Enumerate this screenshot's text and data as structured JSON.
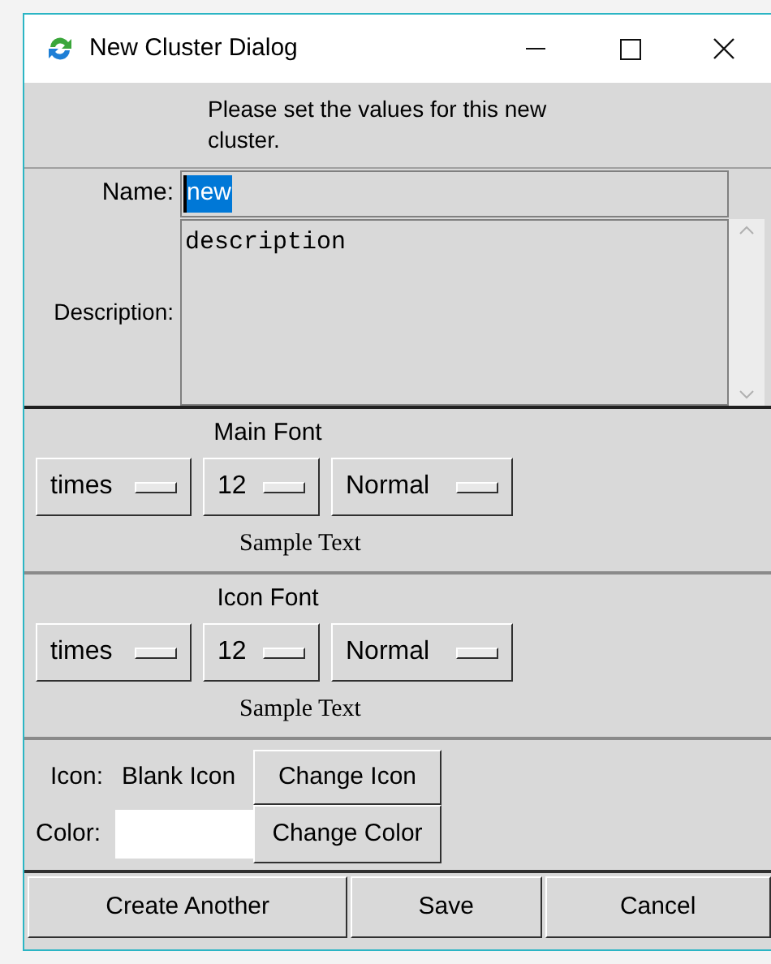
{
  "window": {
    "title": "New Cluster Dialog"
  },
  "message": "Please set the values for this new cluster.",
  "name_field": {
    "label": "Name:",
    "value": "new",
    "text_selected": true
  },
  "description_field": {
    "label": "Description:",
    "value": "description"
  },
  "font_sections": [
    {
      "title": "Main Font",
      "menus": [
        "times",
        "12",
        "Normal"
      ],
      "sample": "Sample Text"
    },
    {
      "title": "Icon Font",
      "menus": [
        "times",
        "12",
        "Normal"
      ],
      "sample": "Sample Text"
    }
  ],
  "icon_row": {
    "label": "Icon:",
    "value": "Blank Icon",
    "button": "Change Icon"
  },
  "color_row": {
    "label": "Color:",
    "color": "#ffffff",
    "button": "Change Color"
  },
  "buttons": [
    "Create Another",
    "Save",
    "Cancel"
  ]
}
